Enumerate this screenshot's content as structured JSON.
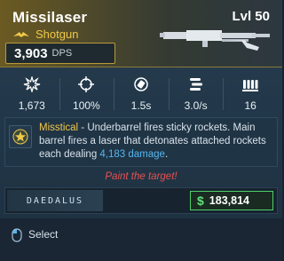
{
  "item": {
    "name": "Missilaser",
    "level": "Lvl 50",
    "type": "Shotgun",
    "dps_value": "3,903",
    "dps_label": "DPS",
    "manufacturer_icon": "wing-icon",
    "weapon_image": "shotgun-silhouette"
  },
  "stats": [
    {
      "icon": "damage-burst-icon",
      "value": "1,673"
    },
    {
      "icon": "accuracy-crosshair-icon",
      "value": "100%"
    },
    {
      "icon": "reload-icon",
      "value": "1.5s"
    },
    {
      "icon": "fire-rate-icon",
      "value": "3.0/s"
    },
    {
      "icon": "magazine-icon",
      "value": "16"
    }
  ],
  "perk": {
    "icon": "star-badge-icon",
    "name": "Misstical",
    "text_before": " - Underbarrel fires sticky rockets. Main barrel fires a laser that detonates attached rockets each dealing ",
    "damage": "4,183 damage",
    "text_after": "."
  },
  "flavor_text": "Paint the target!",
  "manufacturer": "DAEDALUS",
  "price": {
    "symbol": "$",
    "value": "183,814"
  },
  "footer": {
    "action_icon": "mouse-icon",
    "action_label": "Select"
  },
  "colors": {
    "rarity_gold": "#f1c84a",
    "flavor_red": "#e85050",
    "damage_blue": "#56b6f0",
    "price_green": "#60e07a"
  }
}
